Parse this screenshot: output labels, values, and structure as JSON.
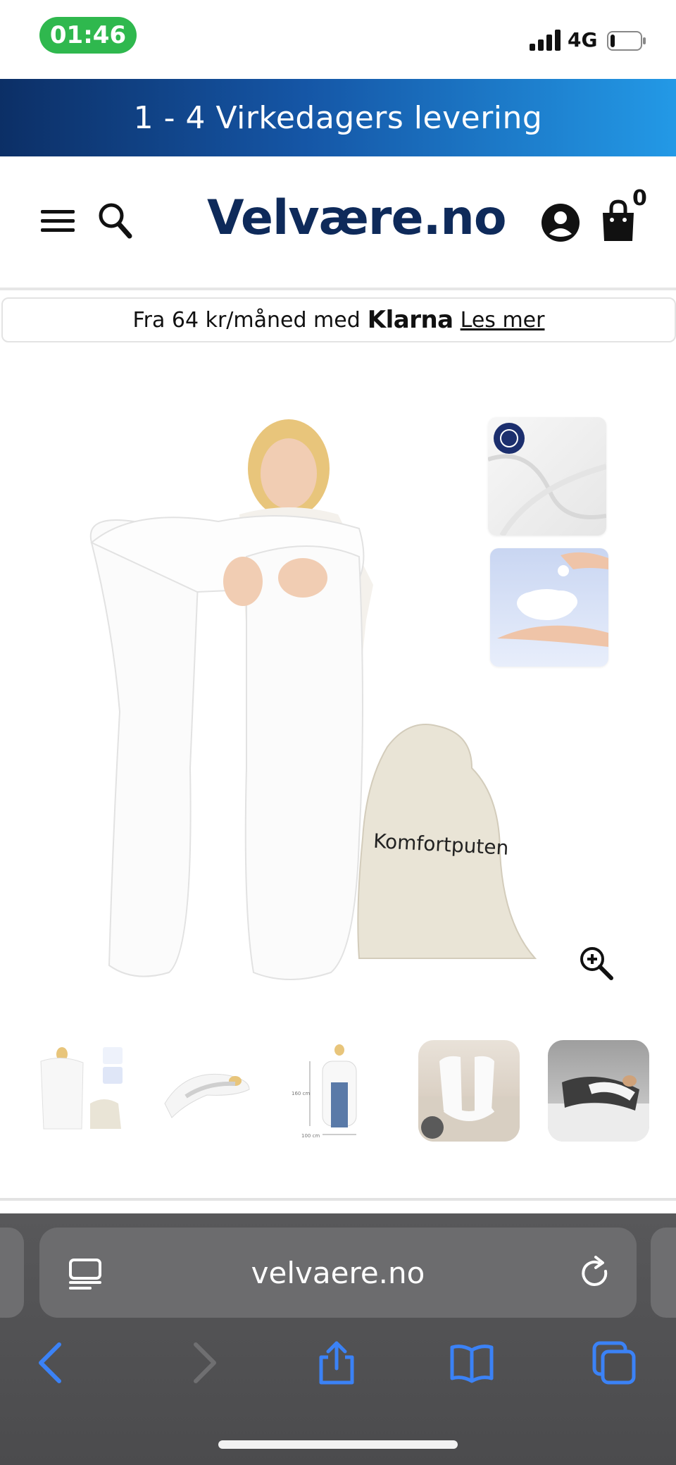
{
  "status_bar": {
    "time": "01:46",
    "network": "4G",
    "battery_level": 0.15
  },
  "promo": {
    "text": "1 - 4 Virkedagers levering"
  },
  "header": {
    "logo_text": "Velvære.no",
    "cart_count": "0",
    "icons": [
      "menu-icon",
      "search-icon",
      "account-icon",
      "cart-icon"
    ]
  },
  "klarna": {
    "prefix": "Fra 64 kr/måned med",
    "brand": "Klarna",
    "link": "Les mer"
  },
  "product": {
    "bag_label": "Komfortputen",
    "zoom_icon": "zoom-in-icon",
    "thumbnail_dim_labels": [
      "160 cm",
      "100 cm"
    ]
  },
  "browser": {
    "url": "velvaere.no",
    "icons": [
      "reader-icon",
      "reload-icon",
      "back-icon",
      "forward-icon",
      "share-icon",
      "bookmarks-icon",
      "tabs-icon"
    ]
  },
  "colors": {
    "brand_navy": "#0e2a5a",
    "promo_start": "#0c2f66",
    "promo_end": "#2399e6",
    "status_green": "#2fb84e",
    "ios_blue": "#3b82f6"
  }
}
